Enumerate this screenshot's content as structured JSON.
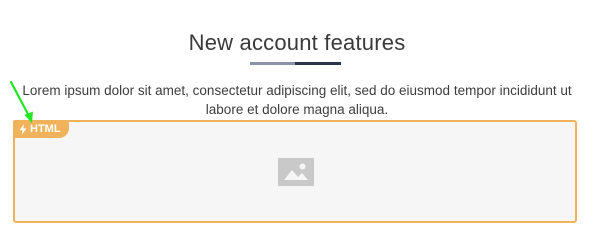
{
  "section": {
    "title": "New account features",
    "description": "Lorem ipsum dolor sit amet, consectetur adipiscing elit, sed do eiusmod tempor incididunt ut labore et dolore magna aliqua."
  },
  "widget": {
    "badge_label": "HTML",
    "badge_icon": "lightning-icon",
    "placeholder_icon": "image-placeholder-icon"
  },
  "colors": {
    "accent": "#f0b25a",
    "heading": "#3a3a3a",
    "underline_light": "#8c93a6",
    "underline_dark": "#2c3648",
    "arrow": "#22e622"
  }
}
